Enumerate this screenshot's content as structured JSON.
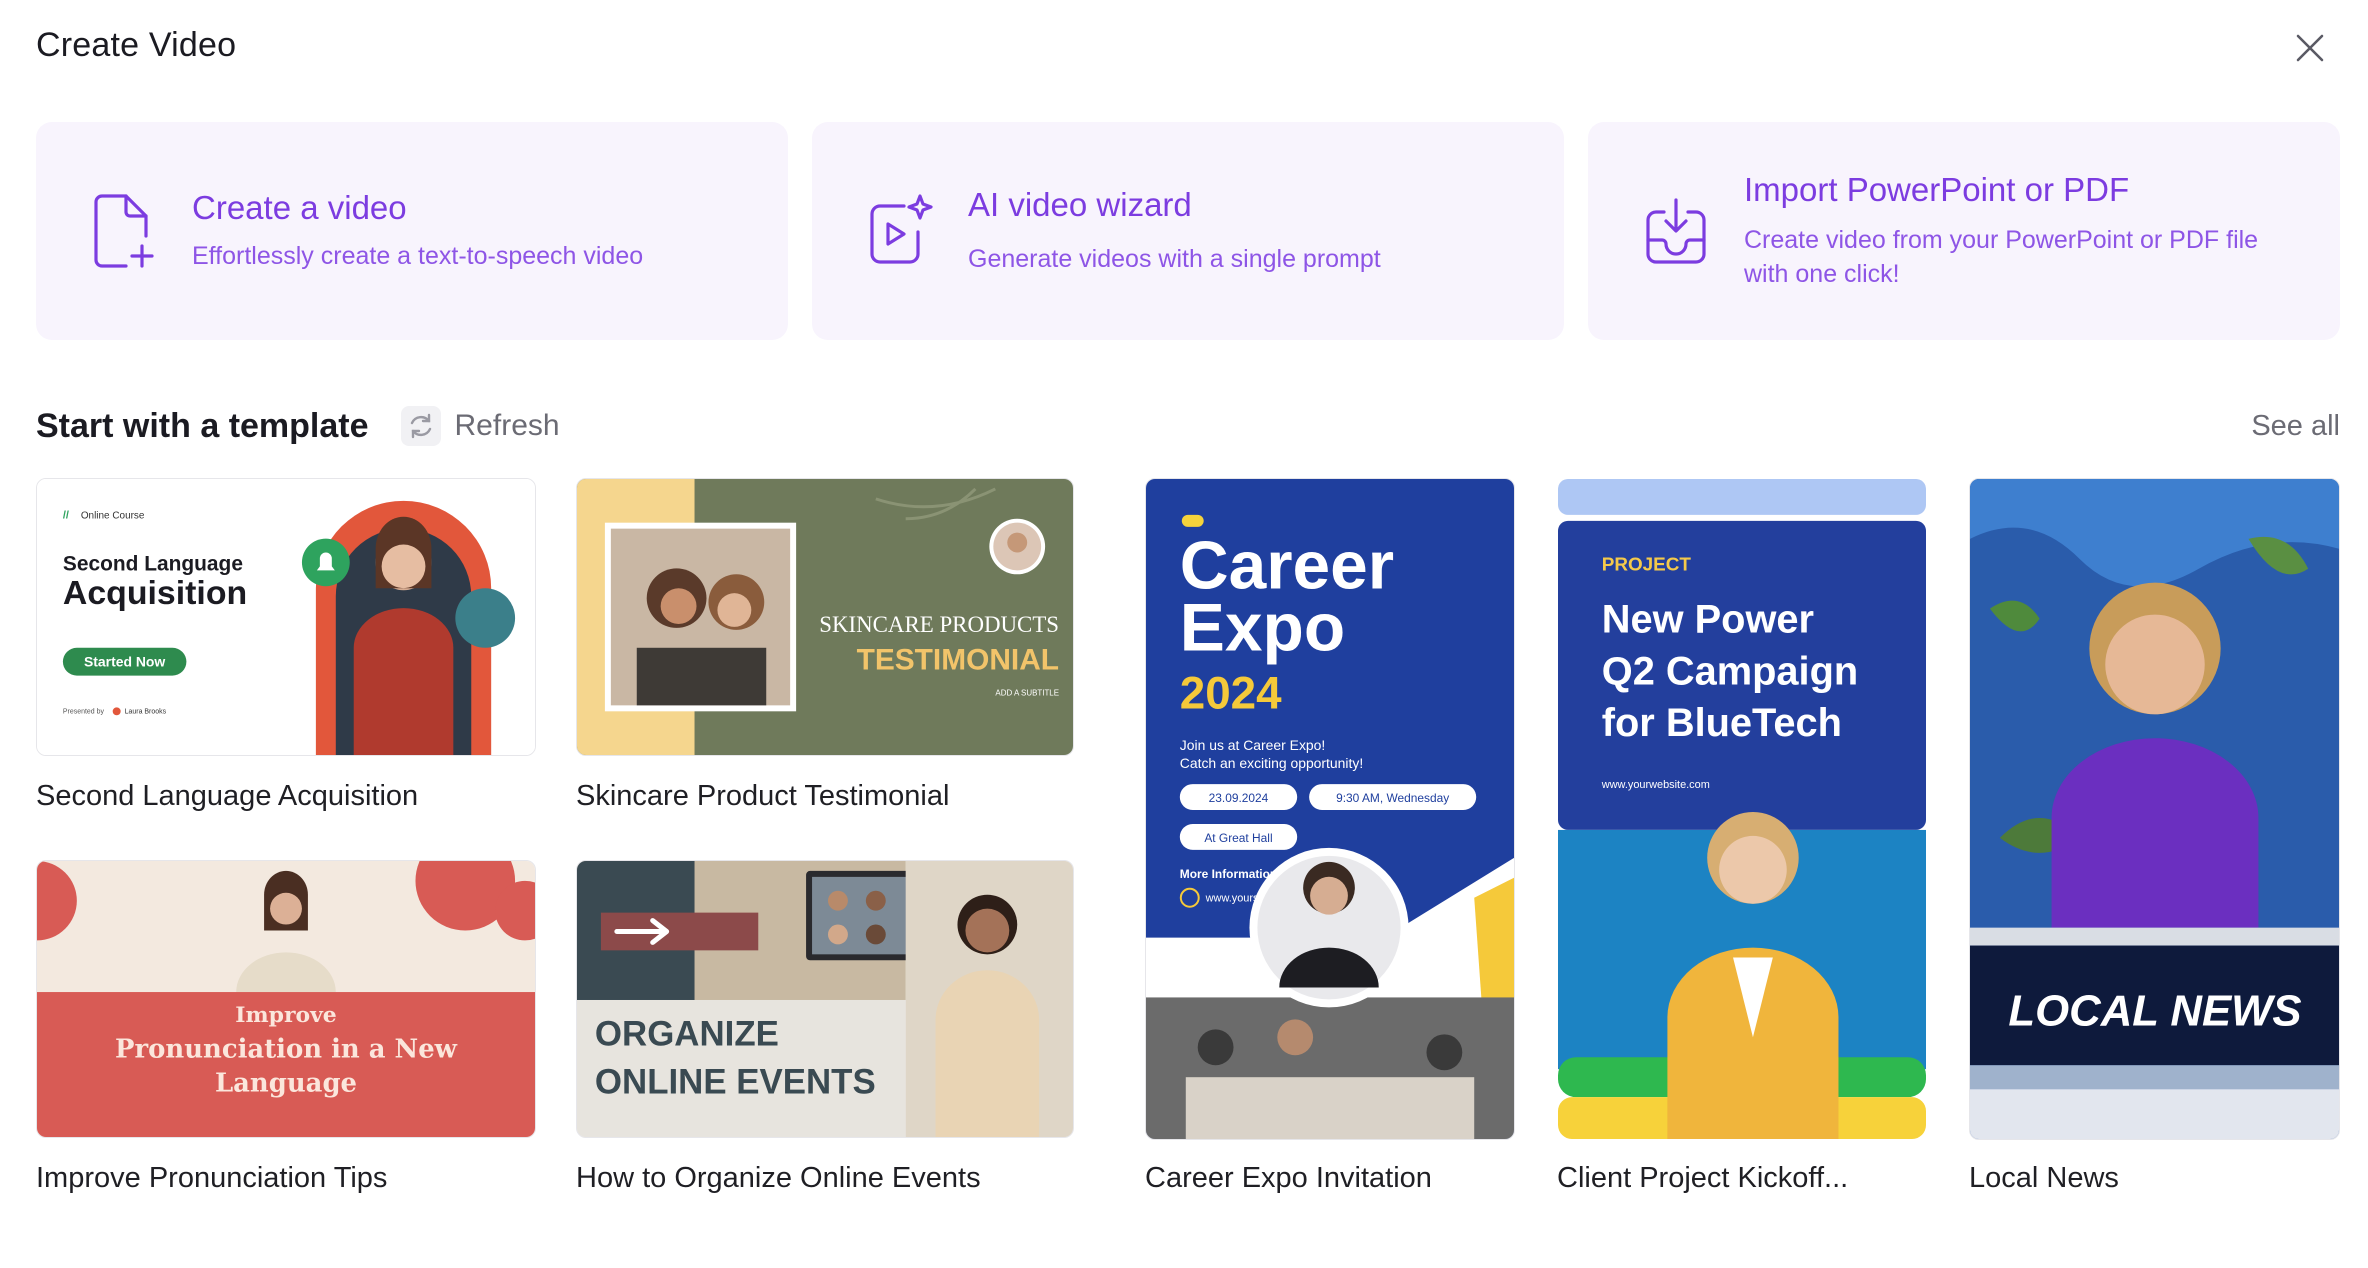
{
  "dialog": {
    "title": "Create Video",
    "close_icon": "close-icon"
  },
  "actions": [
    {
      "title": "Create a video",
      "subtitle": "Effortlessly create a text-to-speech video",
      "icon": "new-file-icon"
    },
    {
      "title": "AI video wizard",
      "subtitle": "Generate videos with a single prompt",
      "icon": "ai-video-icon"
    },
    {
      "title": "Import PowerPoint or PDF",
      "subtitle": "Create video from your PowerPoint or PDF file with one click!",
      "icon": "import-tray-icon"
    }
  ],
  "templates_section": {
    "title": "Start with a template",
    "refresh_label": "Refresh",
    "see_all_label": "See all"
  },
  "templates": [
    {
      "label": "Second Language Acquisition",
      "thumb": {
        "badge": "Online Course",
        "line1": "Second Language",
        "line2": "Acquisition",
        "button": "Started Now",
        "presenter_prefix": "Presented by",
        "presenter": "Laura Brooks"
      }
    },
    {
      "label": "Skincare Product Testimonial",
      "thumb": {
        "line1": "SKINCARE PRODUCTS",
        "line2": "TESTIMONIAL",
        "line3": "ADD A SUBTITLE"
      }
    },
    {
      "label": "Improve Pronunciation Tips",
      "thumb": {
        "line1": "Improve",
        "line2": "Pronunciation in a New",
        "line3": "Language"
      }
    },
    {
      "label": "How to Organize Online Events",
      "thumb": {
        "line1": "ORGANIZE",
        "line2": "ONLINE EVENTS"
      }
    },
    {
      "label": "Career Expo Invitation",
      "thumb": {
        "line1": "Career",
        "line2": "Expo",
        "year": "2024",
        "intro1": "Join us at Career Expo!",
        "intro2": "Catch an exciting opportunity!",
        "date": "23.09.2024",
        "time": "9:30 AM, Wednesday",
        "venue": "At Great Hall",
        "more": "More Information:",
        "site": "www.yoursite.com"
      }
    },
    {
      "label": "Client Project Kickoff...",
      "thumb": {
        "kicker": "PROJECT",
        "line1": "New Power",
        "line2": "Q2 Campaign",
        "line3": "for BlueTech",
        "site": "www.yourwebsite.com"
      }
    },
    {
      "label": "Local News",
      "thumb": {
        "banner": "LOCAL NEWS"
      }
    }
  ],
  "colors": {
    "accent": "#7c3ce0",
    "action_bg": "#f8f4fd"
  }
}
